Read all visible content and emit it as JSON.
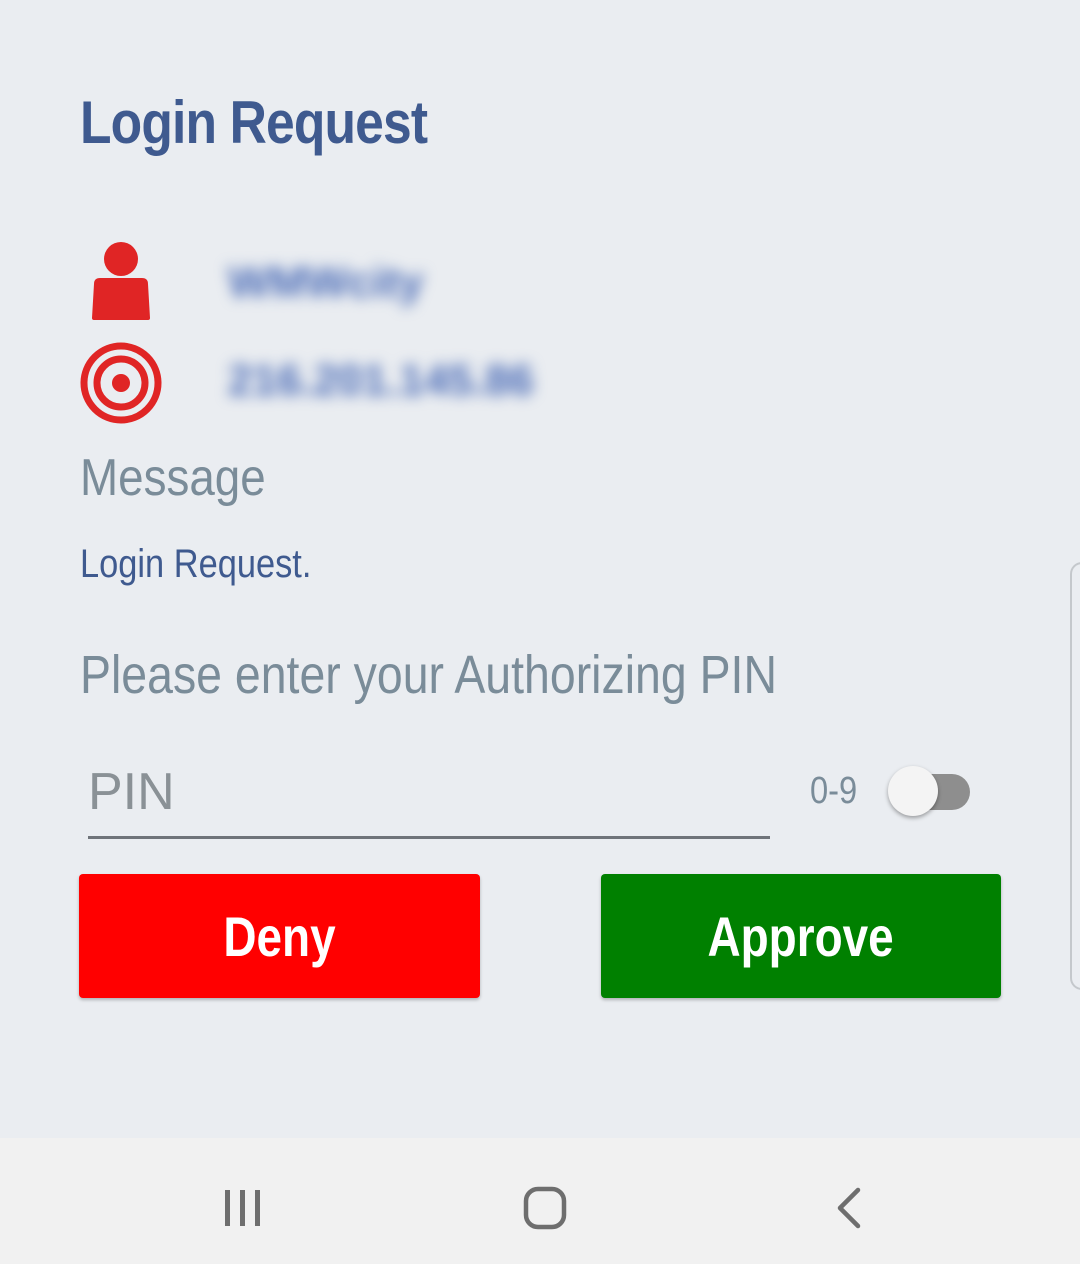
{
  "title": "Login Request",
  "requester": {
    "username": "WMWcity",
    "ip_address": "216.201.145.86"
  },
  "message": {
    "label": "Message",
    "text": "Login Request."
  },
  "pin": {
    "prompt": "Please enter your Authorizing PIN",
    "placeholder": "PIN",
    "value": "",
    "keypad_toggle_label": "0-9",
    "keypad_toggle_on": false
  },
  "actions": {
    "deny_label": "Deny",
    "approve_label": "Approve"
  },
  "colors": {
    "title": "#3f5a8f",
    "deny": "#ff0000",
    "approve": "#008000",
    "icon_red": "#e02525"
  },
  "icons": {
    "user": "user-icon",
    "target": "target-icon",
    "recent": "recent-apps-icon",
    "home": "home-icon",
    "back": "back-icon"
  }
}
